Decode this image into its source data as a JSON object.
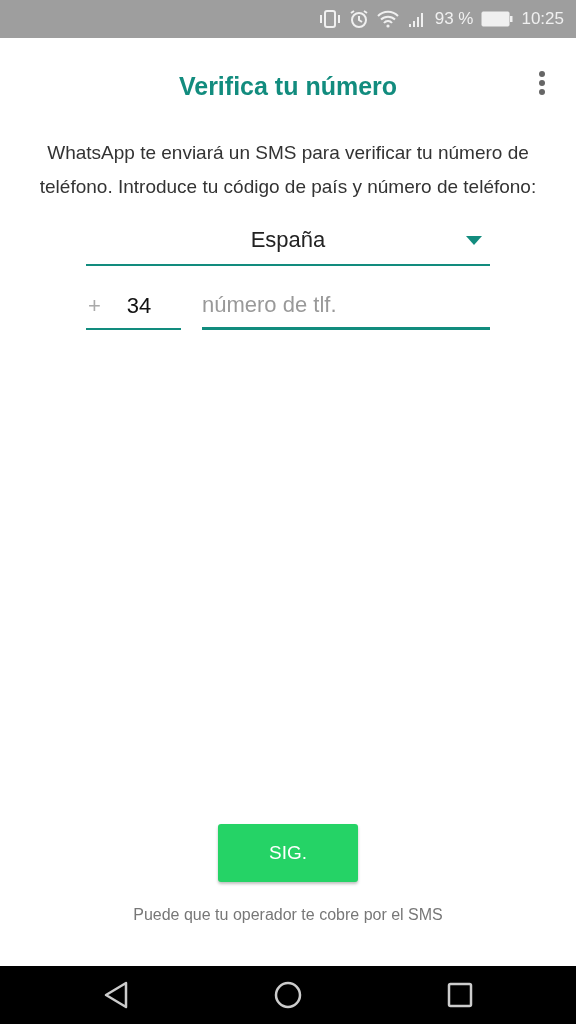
{
  "status_bar": {
    "battery_percent": "93 %",
    "time": "10:25"
  },
  "title": "Verifica tu número",
  "description": "WhatsApp te enviará un SMS para verificar tu número de teléfono. Introduce tu código de país y número de teléfono:",
  "country_select": {
    "value": "España"
  },
  "phone": {
    "prefix": "+",
    "country_code": "34",
    "placeholder": "número de tlf."
  },
  "next_button": "SIG.",
  "footer_note": "Puede que tu operador te cobre por el SMS"
}
